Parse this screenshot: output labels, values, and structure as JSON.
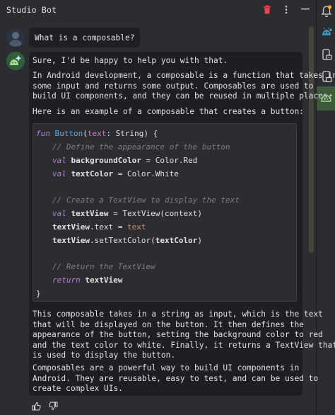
{
  "header": {
    "title": "Studio Bot"
  },
  "user_message": {
    "text": "What is a composable?"
  },
  "bot_message": {
    "paragraphs": [
      "Sure, I'd be happy to help you with that.",
      "In Android development, a composable is a function that takes in\nsome input and returns some output. Composables are used to\nbuild UI components, and they can be reused in multiple places.",
      "Here is an example of a composable that creates a button:",
      "This composable takes in a string as input, which is the text\nthat will be displayed on the button. It then defines the\nappearance of the button, setting the background color to red\nand the text color to white. Finally, it returns a TextView that\nis used to display the button.",
      "Composables are a powerful way to build UI components in\nAndroid. They are reusable, easy to test, and can be used to\ncreate complex UIs."
    ],
    "code": {
      "l1_kw": "fun",
      "l1_fn": "Button",
      "l1_open": "(",
      "l1_param": "text",
      "l1_colon": ": ",
      "l1_type": "String",
      "l1_close": ") {",
      "c1": "// Define the appearance of the button",
      "l2_kw": "val",
      "l2_name": "backgroundColor",
      "l2_rest": " = Color.Red",
      "l3_kw": "val",
      "l3_name": "textColor",
      "l3_rest": " = Color.White",
      "c2": "// Create a TextView to display the text",
      "l4_kw": "val",
      "l4_name": "textView",
      "l4_rest": " = TextView(context)",
      "l5_name": "textView",
      "l5_mid": ".text = ",
      "l5_val": "text",
      "l6_name": "textView",
      "l6_mid": ".setTextColor(",
      "l6_arg": "textColor",
      "l6_end": ")",
      "c3": "// Return the TextView",
      "l7_kw": "return",
      "l7_name": "textView",
      "end": "}"
    }
  },
  "colors": {
    "accent_active": "#3d5a3a",
    "delete": "#e5484d",
    "avatar_bg": "#2f5f3a"
  },
  "icons": {
    "header": [
      "trash-icon",
      "more-vertical-icon",
      "minimize-icon"
    ],
    "right_bar": [
      "notification-icon",
      "gemini-android-icon",
      "device-manager-icon",
      "running-devices-icon",
      "studio-bot-icon"
    ],
    "feedback": [
      "thumbs-up-icon",
      "thumbs-down-icon"
    ]
  }
}
